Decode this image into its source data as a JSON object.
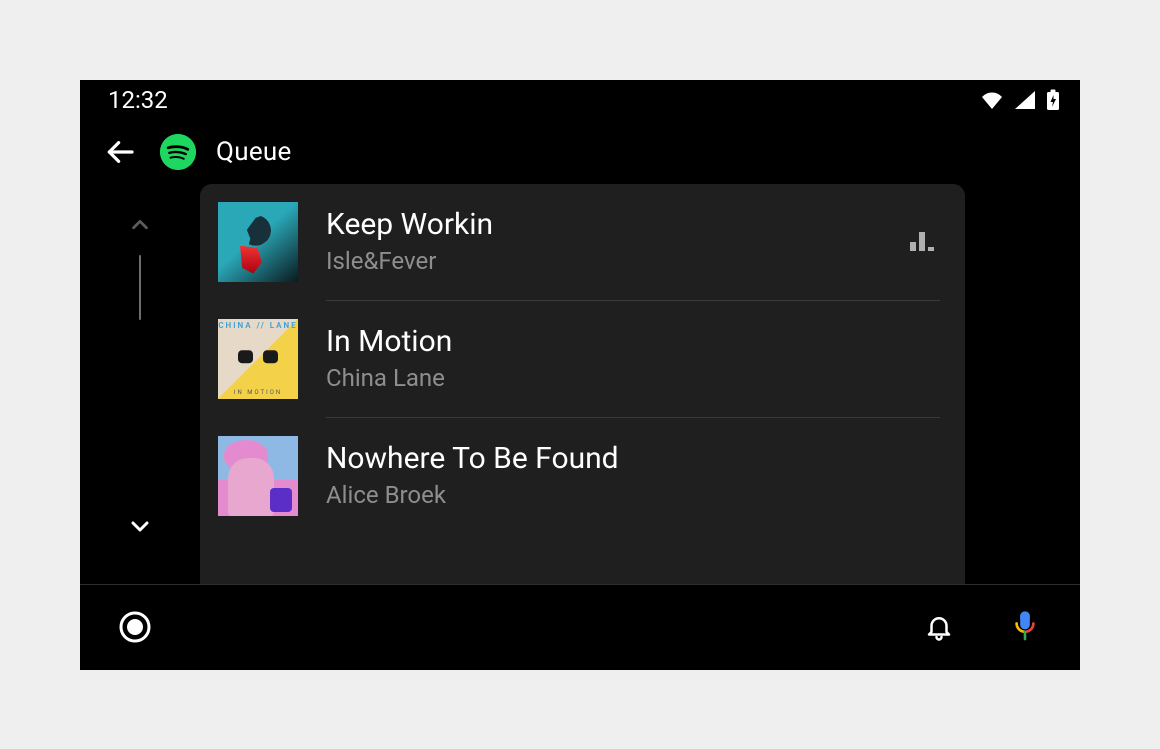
{
  "status": {
    "time": "12:32"
  },
  "header": {
    "title": "Queue"
  },
  "queue": [
    {
      "title": "Keep Workin",
      "artist": "Isle&Fever",
      "playing": true
    },
    {
      "title": "In Motion",
      "artist": "China Lane",
      "playing": false
    },
    {
      "title": "Nowhere To Be Found",
      "artist": "Alice Broek",
      "playing": false
    }
  ]
}
